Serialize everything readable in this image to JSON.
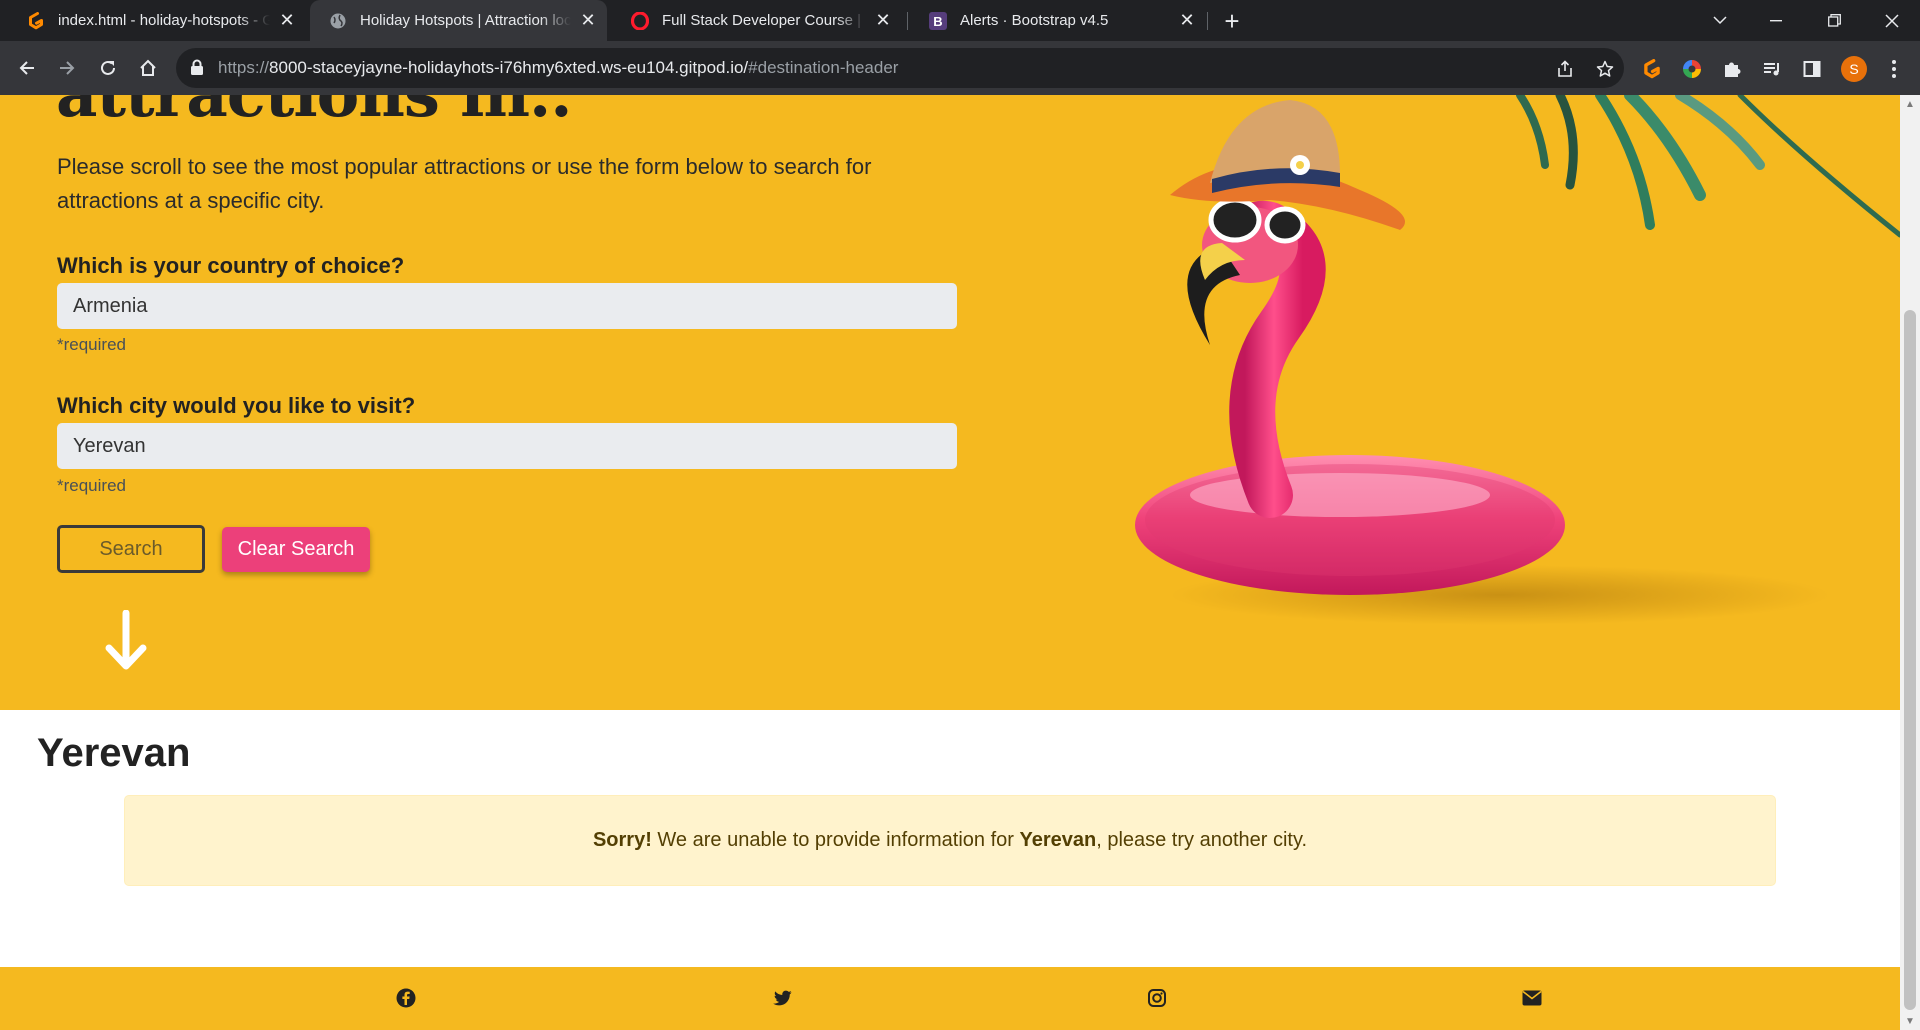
{
  "browser": {
    "tabs": [
      {
        "title": "index.html - holiday-hotspots - Gitpod Code",
        "favicon": "gitpod-icon",
        "active": false
      },
      {
        "title": "Holiday Hotspots | Attraction locator",
        "favicon": "globe-icon",
        "active": true
      },
      {
        "title": "Full Stack Developer Course | Full Stack",
        "favicon": "opera-icon",
        "active": false
      },
      {
        "title": "Alerts · Bootstrap v4.5",
        "favicon": "bootstrap-icon",
        "active": false
      }
    ],
    "new_tab": "+",
    "url_host": "https://8000-staceyjayne-holidayhots-i76hmy6xted.ws-eu104.gitpod.io/",
    "url_host_main": "8000-staceyjayne-holidayhots-i76hmy6xted.ws-eu104.gitpod.io/",
    "url_scheme": "https://",
    "url_fragment": "#destination-header",
    "profile_initial": "S"
  },
  "hero": {
    "heading": "attractions in..",
    "intro": "Please scroll to see the most popular attractions or use the form below to search for attractions at a specific city.",
    "country_label": "Which is your country of choice?",
    "country_value": "Armenia",
    "country_required": "*required",
    "city_label": "Which city would you like to visit?",
    "city_value": "Yerevan",
    "city_required": "*required",
    "search_button": "Search",
    "clear_button": "Clear Search"
  },
  "results": {
    "city_title": "Yerevan",
    "alert_prefix": "Sorry!",
    "alert_middle": " We are unable to provide information for ",
    "alert_city": "Yerevan",
    "alert_suffix": ", please try another city."
  },
  "footer": {
    "icons": [
      "facebook-icon",
      "twitter-icon",
      "instagram-icon",
      "envelope-icon"
    ]
  },
  "colors": {
    "hero_bg": "#f5b91f",
    "clear_button": "#ec407a",
    "alert_bg": "#fff3cd"
  }
}
